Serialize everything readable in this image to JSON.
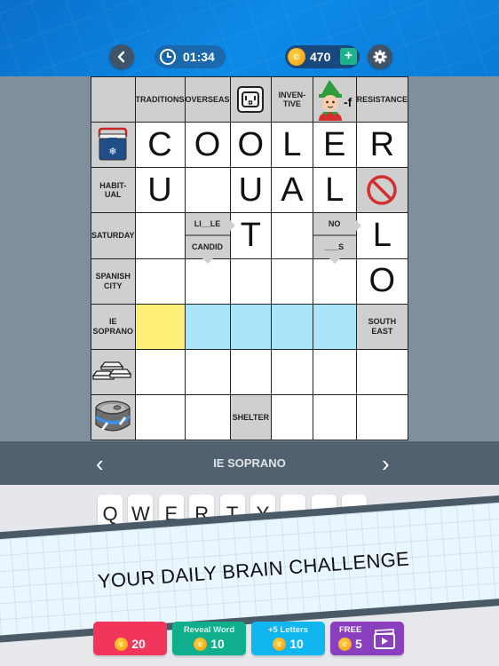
{
  "header": {
    "timer": "01:34",
    "coins": "470",
    "icons": [
      "back-icon",
      "clock-icon",
      "coin-icon",
      "plus-icon",
      "gear-icon"
    ]
  },
  "colors": {
    "header_blue": "#0c8ae6",
    "active_cell": "#fcee76",
    "highlight_cell": "#a9e4fa",
    "clue_cell": "#cfcfcf",
    "hint_red": "#f2355a",
    "reveal_green": "#0fae8c",
    "letters_blue": "#10b6f0",
    "free_purple": "#8a3fbe"
  },
  "grid": {
    "rows": [
      [
        {
          "type": "clue",
          "text": ""
        },
        {
          "type": "clue",
          "text": "TRADITIONS"
        },
        {
          "type": "clue",
          "text": "OVERSEAS"
        },
        {
          "type": "clue-icon",
          "icon": "power-outlet-icon"
        },
        {
          "type": "clue",
          "text": "INVEN-\nTIVE"
        },
        {
          "type": "clue-icon",
          "icon": "elf-icon",
          "suffix": "-f"
        },
        {
          "type": "clue",
          "text": "RESISTANCE"
        }
      ],
      [
        {
          "type": "clue-icon",
          "icon": "cooler-icon"
        },
        {
          "type": "letter",
          "value": "C"
        },
        {
          "type": "letter",
          "value": "O"
        },
        {
          "type": "letter",
          "value": "O"
        },
        {
          "type": "letter",
          "value": "L"
        },
        {
          "type": "letter",
          "value": "E"
        },
        {
          "type": "letter",
          "value": "R"
        }
      ],
      [
        {
          "type": "clue",
          "text": "HABIT-\nUAL"
        },
        {
          "type": "letter",
          "value": "U"
        },
        {
          "type": "letter",
          "value": ""
        },
        {
          "type": "letter",
          "value": "U"
        },
        {
          "type": "letter",
          "value": "A"
        },
        {
          "type": "letter",
          "value": "L"
        },
        {
          "type": "clue-icon",
          "icon": "prohibited-icon"
        }
      ],
      [
        {
          "type": "clue",
          "text": "SATURDAY"
        },
        {
          "type": "letter",
          "value": ""
        },
        {
          "type": "split",
          "top": "LI__LE",
          "bottom": "CANDID"
        },
        {
          "type": "letter",
          "value": "T"
        },
        {
          "type": "letter",
          "value": ""
        },
        {
          "type": "split",
          "top": "NO",
          "bottom": "___S"
        },
        {
          "type": "letter",
          "value": "L"
        }
      ],
      [
        {
          "type": "clue",
          "text": "SPANISH\nCITY"
        },
        {
          "type": "letter",
          "value": ""
        },
        {
          "type": "letter",
          "value": ""
        },
        {
          "type": "letter",
          "value": ""
        },
        {
          "type": "letter",
          "value": ""
        },
        {
          "type": "letter",
          "value": ""
        },
        {
          "type": "letter",
          "value": "O"
        }
      ],
      [
        {
          "type": "clue",
          "text": "IE\nSOPRANO"
        },
        {
          "type": "letter",
          "value": "",
          "state": "active"
        },
        {
          "type": "letter",
          "value": "",
          "state": "hl"
        },
        {
          "type": "letter",
          "value": "",
          "state": "hl"
        },
        {
          "type": "letter",
          "value": "",
          "state": "hl"
        },
        {
          "type": "letter",
          "value": "",
          "state": "hl"
        },
        {
          "type": "clue",
          "text": "SOUTH\nEAST"
        }
      ],
      [
        {
          "type": "clue-icon",
          "icon": "gold-bars-icon"
        },
        {
          "type": "letter",
          "value": ""
        },
        {
          "type": "letter",
          "value": ""
        },
        {
          "type": "letter",
          "value": ""
        },
        {
          "type": "letter",
          "value": ""
        },
        {
          "type": "letter",
          "value": ""
        },
        {
          "type": "letter",
          "value": ""
        }
      ],
      [
        {
          "type": "clue-icon",
          "icon": "tin-can-icon"
        },
        {
          "type": "letter",
          "value": ""
        },
        {
          "type": "letter",
          "value": ""
        },
        {
          "type": "clue",
          "text": "SHELTER"
        },
        {
          "type": "letter",
          "value": ""
        },
        {
          "type": "letter",
          "value": ""
        },
        {
          "type": "letter",
          "value": ""
        }
      ]
    ]
  },
  "clue_bar": {
    "current_clue": "IE SOPRANO",
    "prev": "‹",
    "next": "›"
  },
  "keyboard": {
    "keys": [
      "Q",
      "W",
      "E",
      "R",
      "T",
      "Y",
      "",
      "",
      ""
    ]
  },
  "banner": {
    "text": "YOUR DAILY BRAIN CHALLENGE"
  },
  "powerups": [
    {
      "label": "",
      "cost": "20"
    },
    {
      "label": "Reveal Word",
      "cost": "10"
    },
    {
      "label": "+5 Letters",
      "cost": "10"
    },
    {
      "label": "FREE",
      "cost": "5"
    }
  ]
}
